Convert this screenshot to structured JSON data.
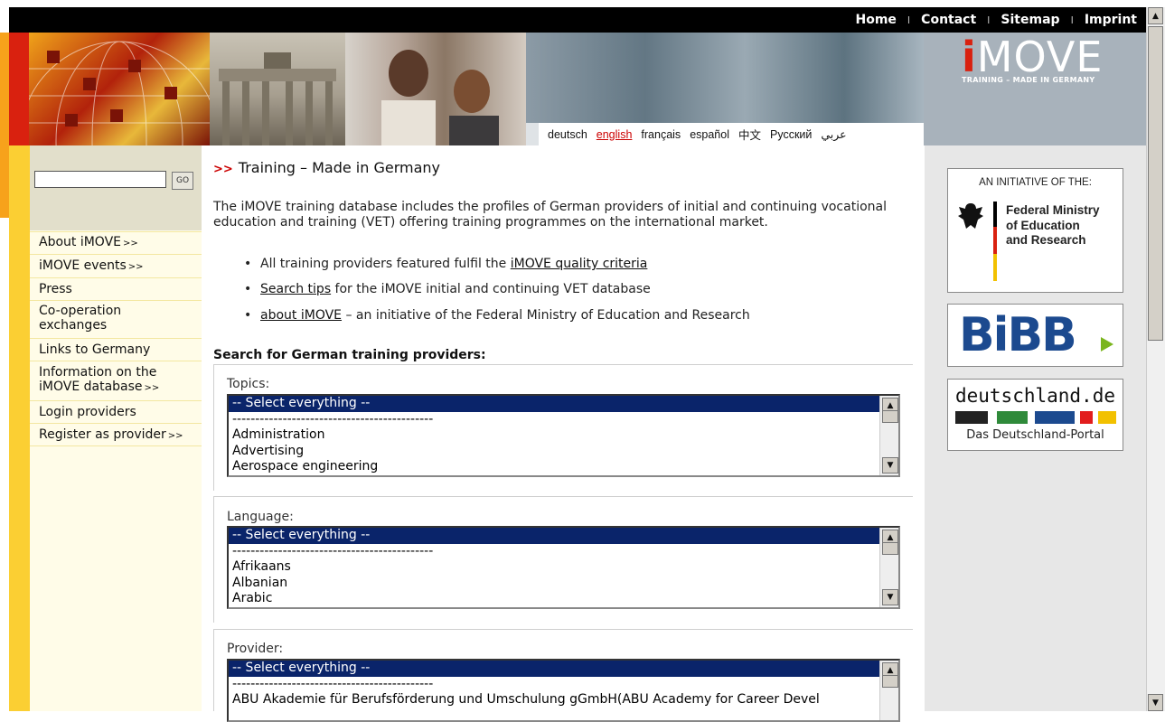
{
  "top_nav": {
    "items": [
      "Home",
      "Contact",
      "Sitemap",
      "Imprint"
    ],
    "separator": "I"
  },
  "logo": {
    "i": "i",
    "text": "MOVE",
    "tagline": "TRAINING – MADE IN GERMANY"
  },
  "languages": {
    "items": [
      "deutsch",
      "english",
      "français",
      "español",
      "中文",
      "Русский",
      "عربي"
    ],
    "active": "english"
  },
  "search": {
    "go_label": "GO",
    "value": ""
  },
  "sidebar": {
    "items": [
      {
        "label": "About iMOVE",
        "arrow": ">>"
      },
      {
        "label": "iMOVE events",
        "arrow": ">>"
      },
      {
        "label": "Press",
        "arrow": ""
      },
      {
        "label": "Co-operation exchanges",
        "arrow": ""
      },
      {
        "label": "Links to Germany",
        "arrow": ""
      },
      {
        "label": "Information on the iMOVE database",
        "arrow": ">>"
      },
      {
        "label": "Login providers",
        "arrow": ""
      },
      {
        "label": "Register as provider",
        "arrow": ">>"
      }
    ]
  },
  "main": {
    "heading_chevron": ">>",
    "heading": "Training – Made in Germany",
    "intro": "The iMOVE training database includes the profiles of German providers of initial and continuing vocational education and training (VET) offering training programmes on the international market.",
    "bullets": [
      {
        "dot": "•",
        "pre": "All training providers featured fulfil the ",
        "link": "iMOVE quality criteria",
        "post": ""
      },
      {
        "dot": "•",
        "pre": "",
        "link": "Search tips",
        "post": " for the iMOVE initial and continuing VET database"
      },
      {
        "dot": "•",
        "pre": "",
        "link": "about iMOVE",
        "post": " – an initiative of the Federal Ministry of Education and Research"
      }
    ],
    "search_title": "Search for German training providers:",
    "fields": {
      "topics": {
        "label": "Topics:",
        "options": [
          "-- Select everything --",
          "--------------------------------------------",
          "Administration",
          "Advertising",
          "Aerospace engineering"
        ]
      },
      "language": {
        "label": "Language:",
        "options": [
          "-- Select everything --",
          "--------------------------------------------",
          "Afrikaans",
          "Albanian",
          "Arabic"
        ]
      },
      "provider": {
        "label": "Provider:",
        "options": [
          "-- Select everything --",
          "--------------------------------------------",
          "ABU Akademie für Berufsförderung und Umschulung gGmbH(ABU Academy for Career Devel"
        ]
      }
    }
  },
  "right": {
    "initiative": {
      "caption": "AN INITIATIVE OF THE:",
      "ministry_line1": "Federal Ministry",
      "ministry_line2": "of Education",
      "ministry_line3": "and Research"
    },
    "bibb": "BiBB",
    "deutschland": {
      "title": "deutschland.de",
      "subtitle": "Das Deutschland-Portal"
    }
  },
  "colors": {
    "accent_red": "#d9210f",
    "left_yellow": "#fbcf33",
    "bibb_blue": "#1c4a8f",
    "bibb_green": "#7ab51d",
    "selection": "#0a246a"
  }
}
